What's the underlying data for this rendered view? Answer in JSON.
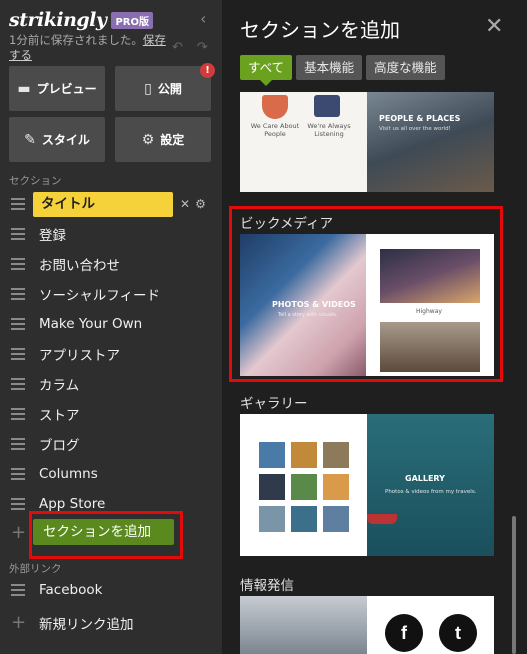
{
  "app": {
    "logo": "strikingly",
    "badge": "PRO版",
    "save_status": "1分前に保存されました。",
    "save_link": "保存する"
  },
  "toolbar": {
    "preview": "プレビュー",
    "publish": "公開",
    "publish_alert": "!",
    "style": "スタイル",
    "settings": "設定"
  },
  "sections": {
    "heading": "セクション",
    "items": [
      {
        "label": "タイトル"
      },
      {
        "label": "登録"
      },
      {
        "label": "お問い合わせ"
      },
      {
        "label": "ソーシャルフィード"
      },
      {
        "label": "Make Your Own"
      },
      {
        "label": "アプリストア"
      },
      {
        "label": "カラム"
      },
      {
        "label": "ストア"
      },
      {
        "label": "ブログ"
      },
      {
        "label": "Columns"
      },
      {
        "label": "App Store"
      }
    ],
    "add_button": "セクションを追加"
  },
  "external_links": {
    "heading": "外部リンク",
    "items": [
      {
        "label": "Facebook"
      }
    ],
    "add_link": "新規リンク追加"
  },
  "panel": {
    "title": "セクションを追加",
    "tabs": [
      {
        "label": "すべて",
        "active": true
      },
      {
        "label": "基本機能",
        "active": false
      },
      {
        "label": "高度な機能",
        "active": false
      }
    ],
    "categories": [
      {
        "title": "",
        "left_head_1": "We Care About People",
        "left_head_2": "We're Always Listening",
        "right_caption": "PEOPLE & PLACES",
        "right_sub": "Visit us all over the world!"
      },
      {
        "title": "ビックメディア",
        "left_caption": "PHOTOS & VIDEOS",
        "left_sub": "Tell a story with visuals.",
        "right_heading": "Highway"
      },
      {
        "title": "ギャラリー",
        "right_caption": "GALLERY",
        "right_sub": "Photos & videos from my travels."
      },
      {
        "title": "情報発信",
        "social_1": "f",
        "social_2": "t"
      }
    ]
  },
  "colors": {
    "accent_green": "#6aa21f",
    "highlight_yellow": "#f6d23a",
    "annotation_red": "#e30a0a",
    "badge_purple": "#8a6fb0"
  }
}
